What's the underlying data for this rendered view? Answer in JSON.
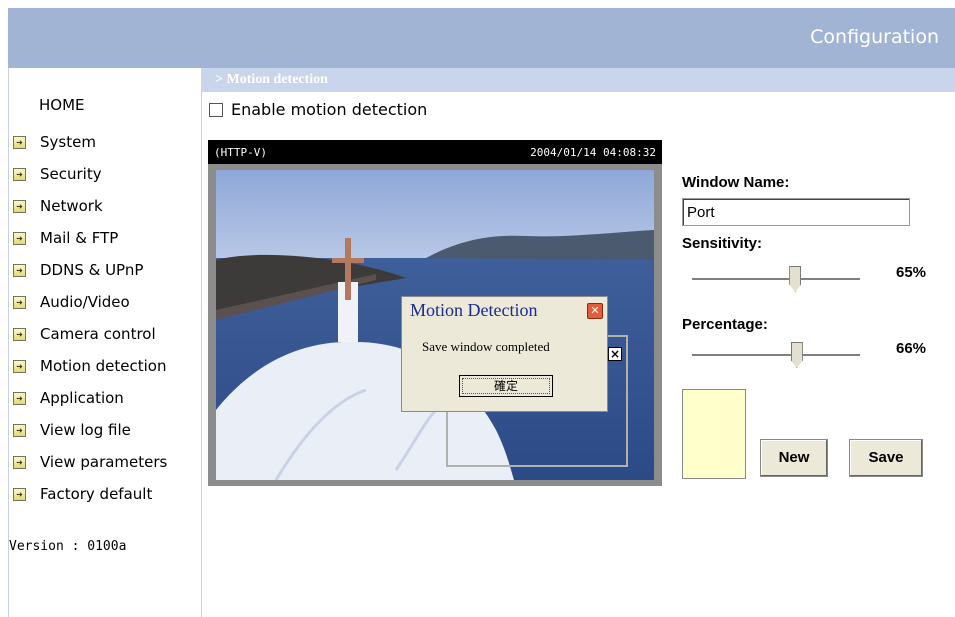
{
  "header": {
    "title": "Configuration"
  },
  "sidebar": {
    "home": "HOME",
    "items": [
      {
        "label": "System"
      },
      {
        "label": "Security"
      },
      {
        "label": "Network"
      },
      {
        "label": "Mail & FTP"
      },
      {
        "label": "DDNS & UPnP"
      },
      {
        "label": "Audio/Video"
      },
      {
        "label": "Camera control"
      },
      {
        "label": "Motion detection"
      },
      {
        "label": "Application"
      },
      {
        "label": "View log file"
      },
      {
        "label": "View parameters"
      },
      {
        "label": "Factory default"
      }
    ],
    "version": "Version : 0100a"
  },
  "section": {
    "title": "> Motion detection"
  },
  "enable": {
    "label": "Enable motion detection",
    "checked": false
  },
  "camera": {
    "source": "(HTTP-V)",
    "timestamp": "2004/01/14 04:08:32",
    "window_close": "×"
  },
  "dialog": {
    "title": "Motion Detection",
    "message": "Save window completed",
    "ok_label": "確定",
    "close_glyph": "✕"
  },
  "settings": {
    "window_name_label": "Window Name:",
    "window_name_value": "Port",
    "sensitivity_label": "Sensitivity:",
    "sensitivity_value": 65,
    "sensitivity_text": "65%",
    "percentage_label": "Percentage:",
    "percentage_value": 66,
    "percentage_text": "66%",
    "swatch_color": "#ffffcc"
  },
  "buttons": {
    "new_label": "New",
    "save_label": "Save"
  },
  "colors": {
    "header_bg": "#a2b4d3",
    "section_bg": "#c9d5ea"
  }
}
